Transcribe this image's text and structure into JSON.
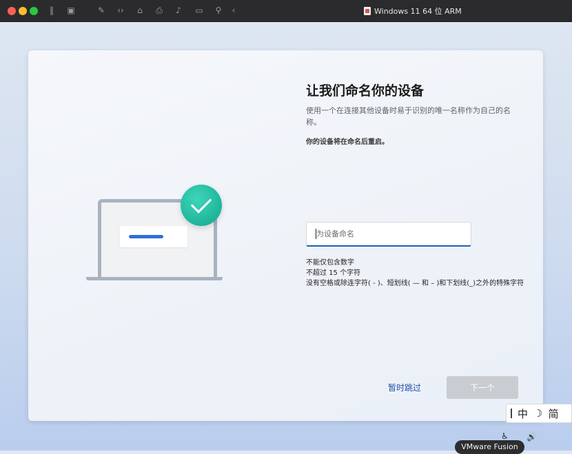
{
  "window": {
    "title": "Windows 11 64 位 ARM",
    "toolbar_icons": [
      "pause-icon",
      "snapshot-icon",
      "settings-wrench-icon",
      "code-icon",
      "disk-icon",
      "printer-icon",
      "sound-icon",
      "camera-icon",
      "usb-icon",
      "back-chevron-icon"
    ]
  },
  "setup": {
    "heading": "让我们命名你的设备",
    "description": "使用一个在连接其他设备时易于识别的唯一名称作为自己的名称。",
    "restart_note": "你的设备将在命名后重启。",
    "input": {
      "placeholder": "为设备命名",
      "value": ""
    },
    "rules": [
      "不能仅包含数字",
      "不超过 15 个字符",
      "没有空格或除连字符( - )、短划线( — 和 – )和下划线(_)之外的特殊字符"
    ],
    "skip_label": "暂时跳过",
    "next_label": "下一个"
  },
  "ime": {
    "mode": "中",
    "variant": "简"
  },
  "tooltip": "VMware Fusion",
  "colors": {
    "accent": "#2f6fd6",
    "check": "#1fb59a",
    "link": "#2150a8"
  }
}
